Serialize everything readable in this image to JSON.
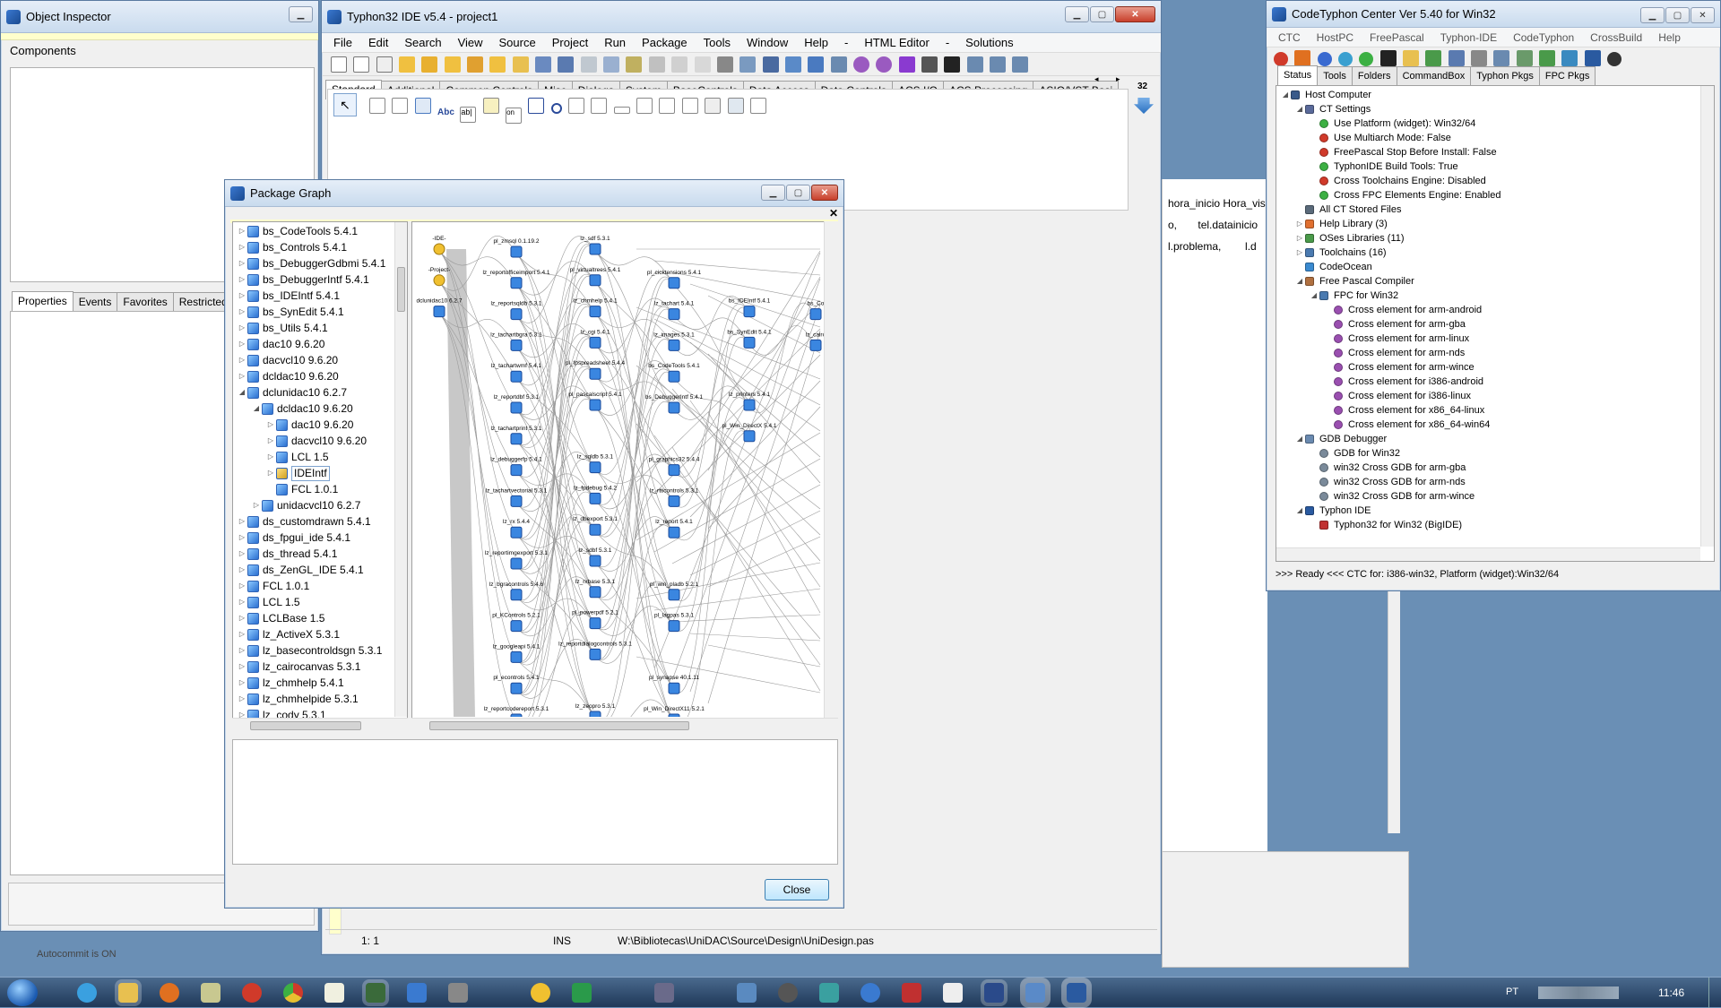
{
  "object_inspector": {
    "title": "Object Inspector",
    "components_label": "Components",
    "tabs": [
      "Properties",
      "Events",
      "Favorites",
      "Restricted"
    ],
    "status_text": "Autocommit is ON"
  },
  "ide": {
    "title": "Typhon32 IDE v5.4 - project1",
    "menu": [
      "File",
      "Edit",
      "Search",
      "View",
      "Source",
      "Project",
      "Run",
      "Package",
      "Tools",
      "Window",
      "Help",
      "-",
      "HTML Editor",
      "-",
      "Solutions"
    ],
    "palette_tabs": [
      "Standard",
      "Additional",
      "Common Controls",
      "Misc",
      "Dialogs",
      "System",
      "BaseControls",
      "Data Access",
      "Data Controls",
      "ACS I/O",
      "ACS Processing",
      "ASIO/VST Basi"
    ],
    "palette_count": "32",
    "statusbar": {
      "position": "1:  1",
      "mode": "INS",
      "file": "W:\\Bibliotecas\\UniDAC\\Source\\Design\\UniDesign.pas"
    }
  },
  "background_editor": {
    "line1": [
      "hora_inicio",
      "Hora_visit"
    ],
    "line2": [
      "o,",
      "tel.datainicio"
    ],
    "line3": [
      "l.problema,",
      "l.d"
    ]
  },
  "package_graph": {
    "title": "Package Graph",
    "close_button": "Close",
    "tree": [
      {
        "label": "bs_CodeTools 5.4.1",
        "level": 0
      },
      {
        "label": "bs_Controls 5.4.1",
        "level": 0
      },
      {
        "label": "bs_DebuggerGdbmi 5.4.1",
        "level": 0
      },
      {
        "label": "bs_DebuggerIntf 5.4.1",
        "level": 0
      },
      {
        "label": "bs_IDEIntf 5.4.1",
        "level": 0
      },
      {
        "label": "bs_SynEdit 5.4.1",
        "level": 0
      },
      {
        "label": "bs_Utils 5.4.1",
        "level": 0
      },
      {
        "label": "dac10 9.6.20",
        "level": 0
      },
      {
        "label": "dacvcl10 9.6.20",
        "level": 0
      },
      {
        "label": "dcldac10 9.6.20",
        "level": 0
      },
      {
        "label": "dclunidac10 6.2.7",
        "level": 0,
        "expanded": true
      },
      {
        "label": "dcldac10 9.6.20",
        "level": 1,
        "expanded": true
      },
      {
        "label": "dac10 9.6.20",
        "level": 2
      },
      {
        "label": "dacvcl10 9.6.20",
        "level": 2
      },
      {
        "label": "LCL 1.5",
        "level": 2
      },
      {
        "label": "IDEIntf",
        "level": 2,
        "selected": true
      },
      {
        "label": "FCL 1.0.1",
        "level": 2,
        "leaf": true
      },
      {
        "label": "unidacvcl10 6.2.7",
        "level": 1
      },
      {
        "label": "ds_customdrawn 5.4.1",
        "level": 0
      },
      {
        "label": "ds_fpgui_ide 5.4.1",
        "level": 0
      },
      {
        "label": "ds_thread 5.4.1",
        "level": 0
      },
      {
        "label": "ds_ZenGL_IDE 5.4.1",
        "level": 0
      },
      {
        "label": "FCL 1.0.1",
        "level": 0
      },
      {
        "label": "LCL 1.5",
        "level": 0
      },
      {
        "label": "LCLBase 1.5",
        "level": 0
      },
      {
        "label": "lz_ActiveX 5.3.1",
        "level": 0
      },
      {
        "label": "lz_basecontroldsgn 5.3.1",
        "level": 0
      },
      {
        "label": "lz_cairocanvas 5.3.1",
        "level": 0
      },
      {
        "label": "lz_chmhelp 5.4.1",
        "level": 0
      },
      {
        "label": "lz_chmhelpide 5.3.1",
        "level": 0
      },
      {
        "label": "lz_cody 5.3.1",
        "level": 0
      }
    ],
    "graph_nodes": [
      {
        "label": "-IDE-",
        "col": 0,
        "row": 0,
        "kind": "root"
      },
      {
        "label": "-Project-",
        "col": 0,
        "row": 1,
        "kind": "root"
      },
      {
        "label": "dclunidac10 6.2.7",
        "col": 0,
        "row": 2
      },
      {
        "label": "pl_zmsql 0.1.19.2",
        "col": 1,
        "row": 0
      },
      {
        "label": "lz_reportofficeimport 5.4.1",
        "col": 1,
        "row": 1
      },
      {
        "label": "lz_reportsqldb 5.3.1",
        "col": 1,
        "row": 2
      },
      {
        "label": "lz_tachartbgra 5.3.1",
        "col": 1,
        "row": 3
      },
      {
        "label": "lz_tachartwmf 5.4.1",
        "col": 1,
        "row": 4
      },
      {
        "label": "lz_reportdbf 5.3.1",
        "col": 1,
        "row": 5
      },
      {
        "label": "lz_tachartprint 5.3.1",
        "col": 1,
        "row": 6
      },
      {
        "label": "lz_debuggerfp 5.4.1",
        "col": 1,
        "row": 7
      },
      {
        "label": "lz_tachartvectorial 5.3.1",
        "col": 1,
        "row": 8
      },
      {
        "label": "lz_rx 5.4.4",
        "col": 1,
        "row": 9
      },
      {
        "label": "lz_reportimgexport 5.3.1",
        "col": 1,
        "row": 10
      },
      {
        "label": "lz_bgracontrols 5.4.6",
        "col": 1,
        "row": 11
      },
      {
        "label": "pl_KControls 5.2.1",
        "col": 1,
        "row": 12
      },
      {
        "label": "lz_googleapi 5.4.1",
        "col": 1,
        "row": 13
      },
      {
        "label": "pl_econtrols 5.4.1",
        "col": 1,
        "row": 14
      },
      {
        "label": "lz_reportcodereport 5.3.1",
        "col": 1,
        "row": 15
      },
      {
        "label": "lz_sdf 5.3.1",
        "col": 2,
        "row": 0
      },
      {
        "label": "pl_virtualtrees 5.4.1",
        "col": 2,
        "row": 1
      },
      {
        "label": "lz_chmhelp 5.4.1",
        "col": 2,
        "row": 2
      },
      {
        "label": "lz_cgi 5.4.1",
        "col": 2,
        "row": 3
      },
      {
        "label": "pl_fpspreadsheet 5.4.4",
        "col": 2,
        "row": 4
      },
      {
        "label": "pl_pascalscript 5.4.1",
        "col": 2,
        "row": 5
      },
      {
        "label": "lz_sqldb 5.3.1",
        "col": 2,
        "row": 7
      },
      {
        "label": "lz_fpdebug 5.4.2",
        "col": 2,
        "row": 8
      },
      {
        "label": "lz_dbexport 5.3.1",
        "col": 2,
        "row": 9
      },
      {
        "label": "lz_sdbf 5.3.1",
        "col": 2,
        "row": 10
      },
      {
        "label": "lz_rxbase 5.3.1",
        "col": 2,
        "row": 11
      },
      {
        "label": "pl_powerpdf 5.2.1",
        "col": 2,
        "row": 12
      },
      {
        "label": "lz_reportdialogcontrols 5.3.1",
        "col": 2,
        "row": 13
      },
      {
        "label": "lz_zeopro 5.3.1",
        "col": 2,
        "row": 15
      },
      {
        "label": "pl_cicktensions 5.4.1",
        "col": 3,
        "row": 1
      },
      {
        "label": "lz_tachart 5.4.1",
        "col": 3,
        "row": 2
      },
      {
        "label": "lz_images 5.3.1",
        "col": 3,
        "row": 3
      },
      {
        "label": "bs_CodeTools 5.4.1",
        "col": 3,
        "row": 4
      },
      {
        "label": "bs_DebuggerIntf 5.4.1",
        "col": 3,
        "row": 5
      },
      {
        "label": "pl_graphics32 5.4.4",
        "col": 3,
        "row": 7
      },
      {
        "label": "lz_rtticontrols 5.3.1",
        "col": 3,
        "row": 8
      },
      {
        "label": "lz_report 5.4.1",
        "col": 3,
        "row": 9
      },
      {
        "label": "pl_win_pladb 5.2.1",
        "col": 3,
        "row": 11
      },
      {
        "label": "pl_lagpas 5.3.1",
        "col": 3,
        "row": 12
      },
      {
        "label": "pl_synapse 40.1.11",
        "col": 3,
        "row": 14
      },
      {
        "label": "pl_Win_DirectX11 5.2.1",
        "col": 3,
        "row": 15
      },
      {
        "label": "bs_IDEIntf 5.4.1",
        "col": 4,
        "row": 2
      },
      {
        "label": "bs_SynEdit 5.4.1",
        "col": 4,
        "row": 3
      },
      {
        "label": "lz_printers 5.4.1",
        "col": 4,
        "row": 5
      },
      {
        "label": "pl_Win_DirectX 5.4.1",
        "col": 4,
        "row": 6
      },
      {
        "label": "bs_Co",
        "col": 5,
        "row": 2
      },
      {
        "label": "lz_cairo",
        "col": 5,
        "row": 3
      }
    ]
  },
  "codetyphon_center": {
    "title": "CodeTyphon Center Ver 5.40 for Win32",
    "menu": [
      "CTC",
      "HostPC",
      "FreePascal",
      "Typhon-IDE",
      "CodeTyphon",
      "CrossBuild",
      "Help"
    ],
    "tabs": [
      "Status",
      "Tools",
      "Folders",
      "CommandBox",
      "Typhon Pkgs",
      "FPC Pkgs"
    ],
    "tree": [
      {
        "label": "Host Computer",
        "level": 0,
        "icon": "computer"
      },
      {
        "label": "CT Settings",
        "level": 1,
        "icon": "settings"
      },
      {
        "label": "Use Platform (widget): Win32/64",
        "level": 2,
        "icon": "green"
      },
      {
        "label": "Use Multiarch Mode: False",
        "level": 2,
        "icon": "red"
      },
      {
        "label": "FreePascal Stop Before Install: False",
        "level": 2,
        "icon": "red"
      },
      {
        "label": "TyphonIDE Build Tools: True",
        "level": 2,
        "icon": "green"
      },
      {
        "label": "Cross Toolchains Engine: Disabled",
        "level": 2,
        "icon": "red"
      },
      {
        "label": "Cross FPC Elements Engine: Enabled",
        "level": 2,
        "icon": "green"
      },
      {
        "label": "All CT Stored Files",
        "level": 1,
        "icon": "files"
      },
      {
        "label": "Help Library (3)",
        "level": 1,
        "icon": "help"
      },
      {
        "label": "OSes Libraries (11)",
        "level": 1,
        "icon": "libs"
      },
      {
        "label": "Toolchains (16)",
        "level": 1,
        "icon": "gear"
      },
      {
        "label": "CodeOcean",
        "level": 1,
        "icon": "ocean"
      },
      {
        "label": "Free Pascal Compiler",
        "level": 1,
        "icon": "fpc"
      },
      {
        "label": "FPC for Win32",
        "level": 2,
        "icon": "gear"
      },
      {
        "label": "Cross element for arm-android",
        "level": 3,
        "icon": "purple"
      },
      {
        "label": "Cross element for arm-gba",
        "level": 3,
        "icon": "purple"
      },
      {
        "label": "Cross element for arm-linux",
        "level": 3,
        "icon": "purple"
      },
      {
        "label": "Cross element for arm-nds",
        "level": 3,
        "icon": "purple"
      },
      {
        "label": "Cross element for arm-wince",
        "level": 3,
        "icon": "purple"
      },
      {
        "label": "Cross element for i386-android",
        "level": 3,
        "icon": "purple"
      },
      {
        "label": "Cross element for i386-linux",
        "level": 3,
        "icon": "purple"
      },
      {
        "label": "Cross element for x86_64-linux",
        "level": 3,
        "icon": "purple"
      },
      {
        "label": "Cross element for x86_64-win64",
        "level": 3,
        "icon": "purple"
      },
      {
        "label": "GDB Debugger",
        "level": 1,
        "icon": "gdb"
      },
      {
        "label": "GDB for Win32",
        "level": 2,
        "icon": "gray"
      },
      {
        "label": "win32 Cross GDB for arm-gba",
        "level": 2,
        "icon": "gray"
      },
      {
        "label": "win32 Cross GDB for arm-nds",
        "level": 2,
        "icon": "gray"
      },
      {
        "label": "win32 Cross GDB for arm-wince",
        "level": 2,
        "icon": "gray"
      },
      {
        "label": "Typhon IDE",
        "level": 1,
        "icon": "typhon"
      },
      {
        "label": "Typhon32 for Win32 (BigIDE)",
        "level": 2,
        "icon": "typhon32"
      }
    ],
    "status": ">>> Ready <<<  CTC for: i386-win32, Platform (widget):Win32/64"
  },
  "taskbar": {
    "lang": "PT",
    "time": "11:46"
  },
  "colors": {
    "desktop": "#6a8fb5",
    "selection_border": "#7da2ce",
    "green_status": "#3cb043",
    "red_status": "#d03a2a",
    "purple_element": "#9a4fb0"
  }
}
